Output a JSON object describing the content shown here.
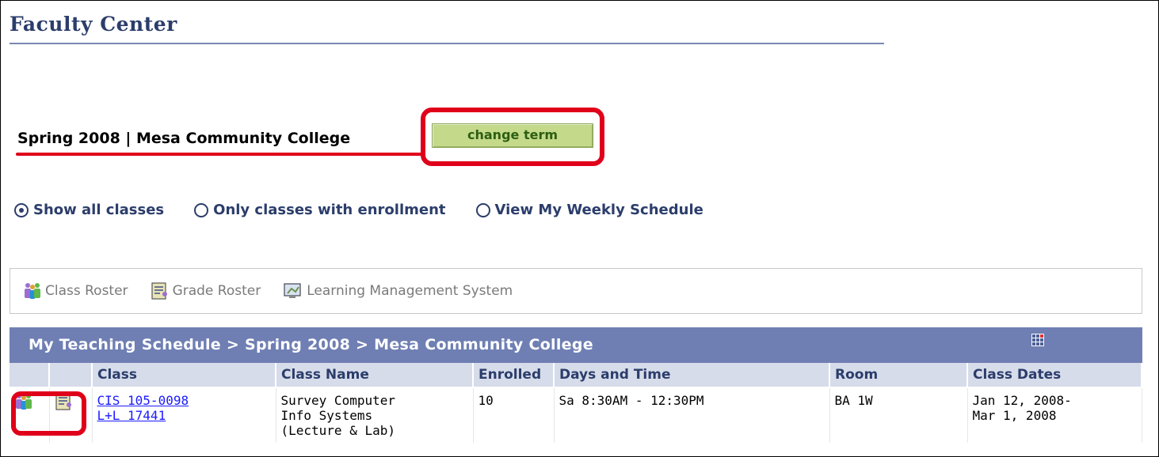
{
  "page": {
    "title": "Faculty Center"
  },
  "term": {
    "label": "Spring 2008 | Mesa Community College",
    "change_term_label": "change term"
  },
  "view_options": [
    {
      "label": "Show all classes",
      "selected": true
    },
    {
      "label": "Only classes with enrollment",
      "selected": false
    },
    {
      "label": "View My Weekly Schedule",
      "selected": false
    }
  ],
  "legend": [
    {
      "label": "Class Roster",
      "icon": "class-roster-icon"
    },
    {
      "label": "Grade Roster",
      "icon": "grade-roster-icon"
    },
    {
      "label": "Learning Management System",
      "icon": "lms-icon"
    }
  ],
  "schedule": {
    "title": "My Teaching Schedule > Spring 2008 > Mesa Community College",
    "columns": [
      "Class",
      "Class Name",
      "Enrolled",
      "Days and Time",
      "Room",
      "Class Dates"
    ],
    "rows": [
      {
        "class_line1": "CIS 105-0098",
        "class_line2": "L+L 17441",
        "class_name_1": "Survey Computer",
        "class_name_2": "Info Systems",
        "class_name_3": "(Lecture & Lab)",
        "enrolled": "10",
        "days_time": "Sa 8:30AM - 12:30PM",
        "room": "BA 1W",
        "dates_1": "Jan 12, 2008-",
        "dates_2": "Mar 1, 2008"
      }
    ]
  },
  "colors": {
    "title": "#2b3d6b",
    "header_bar": "#6f7fb3",
    "column_header": "#d7dcea",
    "button": "#c4d98a",
    "annotation_red": "#e0001a",
    "link": "#1a1aff"
  }
}
